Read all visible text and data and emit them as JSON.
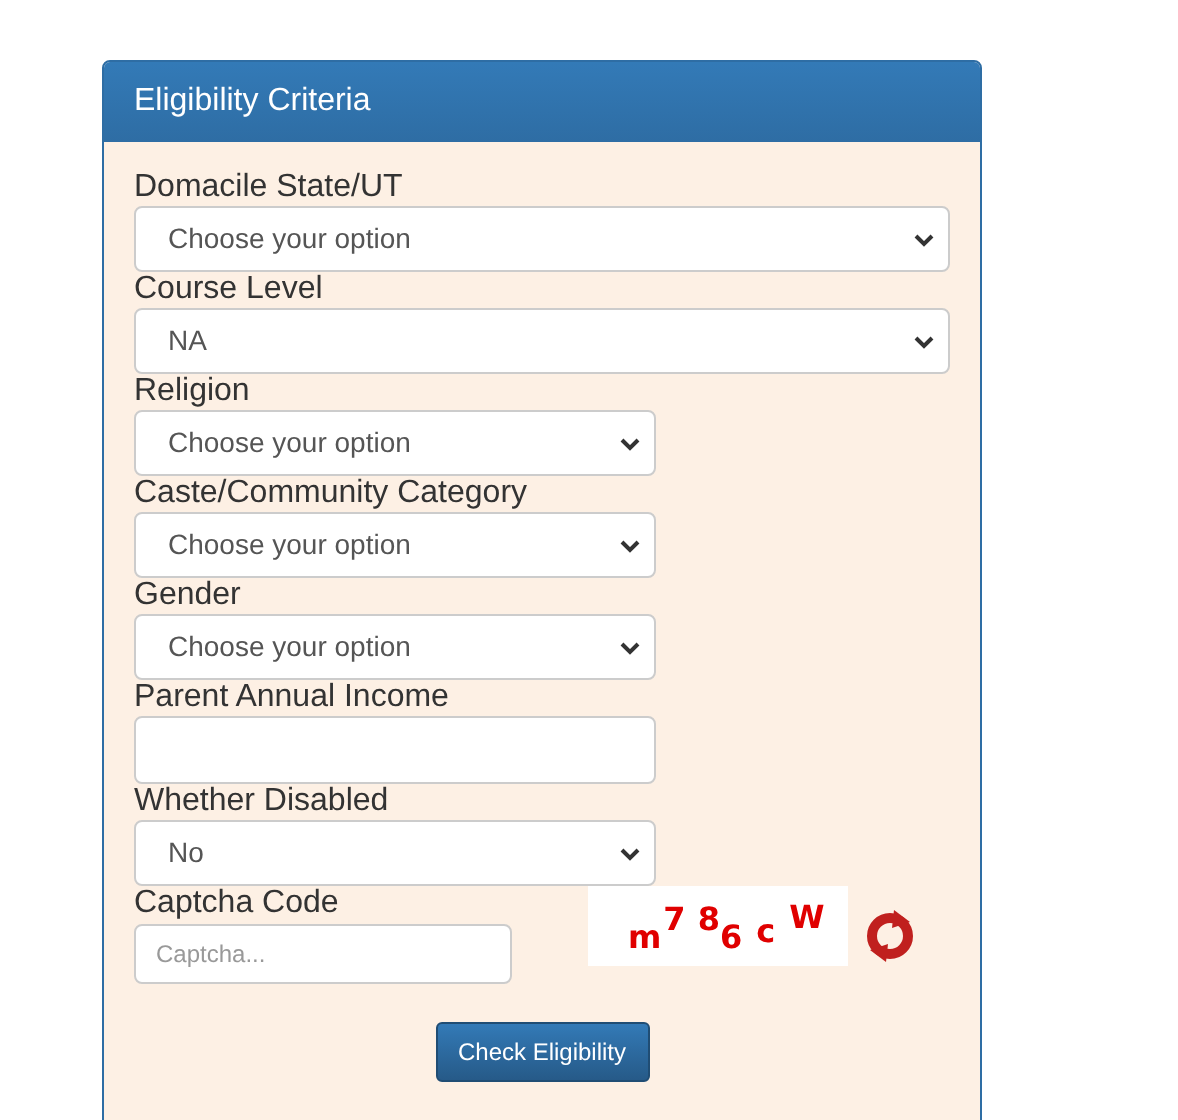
{
  "panel": {
    "title": "Eligibility Criteria"
  },
  "fields": [
    {
      "kind": "select",
      "label": "Domacile State/UT",
      "value": "Choose your option",
      "wide": true
    },
    {
      "kind": "select",
      "label": "Course Level",
      "value": "NA",
      "wide": true
    },
    {
      "kind": "select",
      "label": "Religion",
      "value": "Choose your option",
      "wide": false
    },
    {
      "kind": "select",
      "label": "Caste/Community Category",
      "value": "Choose your option",
      "wide": false
    },
    {
      "kind": "select",
      "label": "Gender",
      "value": "Choose your option",
      "wide": false
    },
    {
      "kind": "input",
      "label": "Parent Annual Income",
      "wide": false
    },
    {
      "kind": "select",
      "label": "Whether Disabled",
      "value": "No",
      "wide": false
    }
  ],
  "captcha": {
    "label": "Captcha Code",
    "placeholder": "Captcha...",
    "characters": [
      "m",
      "7",
      "8",
      "6",
      "c",
      "W"
    ]
  },
  "button": "Check Eligibility"
}
